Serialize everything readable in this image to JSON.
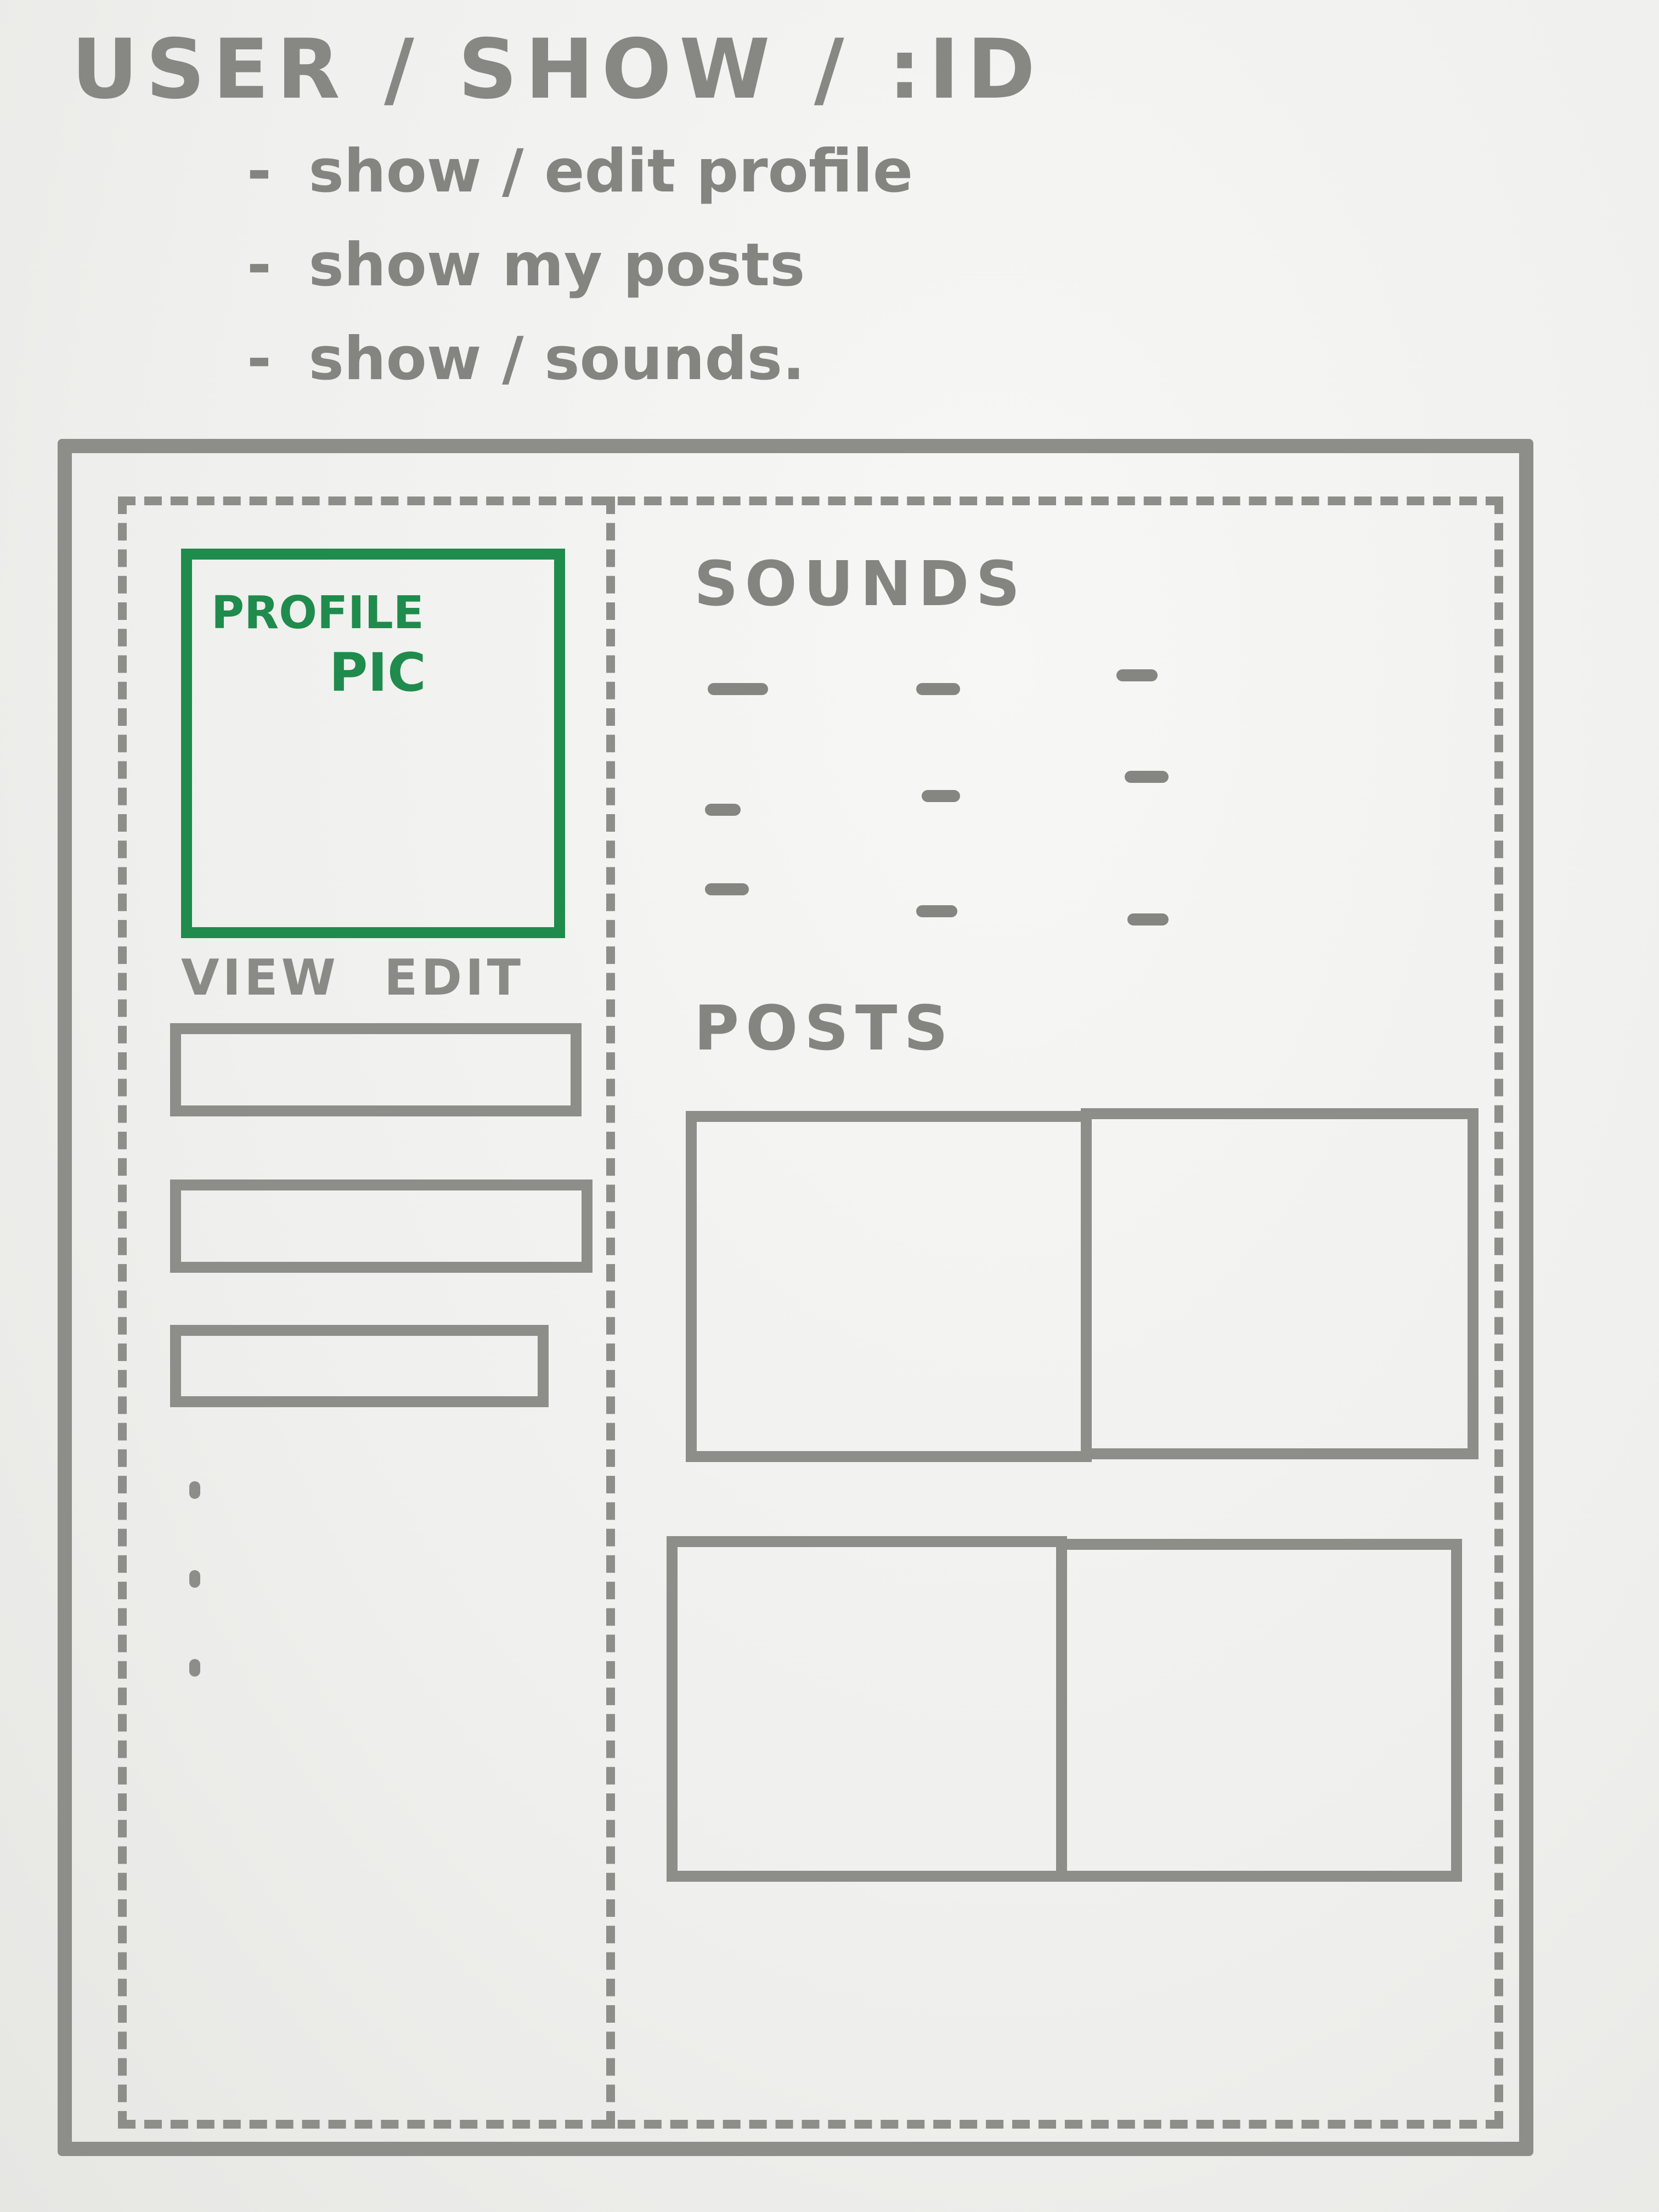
{
  "header": {
    "title": "USER / SHOW / :ID",
    "notes": [
      {
        "dash": "-",
        "text": "show / edit profile"
      },
      {
        "dash": "-",
        "text": "show my posts"
      },
      {
        "dash": "-",
        "text": "show / sounds."
      }
    ]
  },
  "profile": {
    "pic_line1": "PROFILE",
    "pic_line2": "PIC",
    "view_label": "VIEW",
    "edit_label": "EDIT",
    "accent_color": "#1f8b4c"
  },
  "sounds": {
    "label": "SOUNDS",
    "item_count": 9
  },
  "posts": {
    "label": "POSTS",
    "item_count": 4
  },
  "colors": {
    "ink": "#8d8e8a",
    "paper": "#f1f1ef"
  }
}
